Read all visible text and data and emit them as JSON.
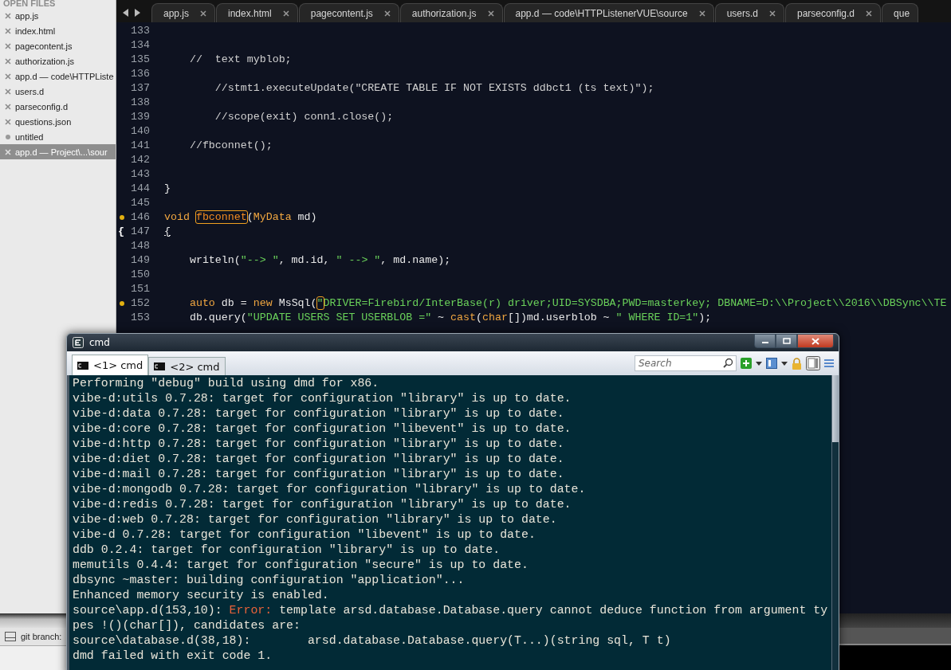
{
  "sidebar": {
    "header": "OPEN FILES",
    "items": [
      {
        "label": "app.js",
        "modified": false,
        "selected": false
      },
      {
        "label": "index.html",
        "modified": false,
        "selected": false
      },
      {
        "label": "pagecontent.js",
        "modified": false,
        "selected": false
      },
      {
        "label": "authorization.js",
        "modified": false,
        "selected": false
      },
      {
        "label": "app.d — code\\HTTPListe",
        "modified": false,
        "selected": false
      },
      {
        "label": "users.d",
        "modified": false,
        "selected": false
      },
      {
        "label": "parseconfig.d",
        "modified": false,
        "selected": false
      },
      {
        "label": "questions.json",
        "modified": false,
        "selected": false
      },
      {
        "label": "untitled",
        "modified": true,
        "selected": false
      },
      {
        "label": "app.d — Project\\...\\sour",
        "modified": false,
        "selected": true
      }
    ]
  },
  "tabs": [
    {
      "label": "app.js"
    },
    {
      "label": "index.html"
    },
    {
      "label": "pagecontent.js"
    },
    {
      "label": "authorization.js"
    },
    {
      "label": "app.d — code\\HTTPListenerVUE\\source"
    },
    {
      "label": "users.d"
    },
    {
      "label": "parseconfig.d"
    },
    {
      "label": "que"
    }
  ],
  "editor": {
    "lines": [
      {
        "number": "133",
        "marker": false
      },
      {
        "number": "134",
        "marker": false
      },
      {
        "number": "135",
        "marker": false,
        "segments": [
          {
            "text": "    //  text myblob;",
            "kind": "comment"
          }
        ]
      },
      {
        "number": "136",
        "marker": false
      },
      {
        "number": "137",
        "marker": false,
        "segments": [
          {
            "text": "        //stmt1.executeUpdate(\"CREATE TABLE IF NOT EXISTS ddbct1 (ts text)\");",
            "kind": "comment"
          }
        ]
      },
      {
        "number": "138",
        "marker": false
      },
      {
        "number": "139",
        "marker": false,
        "segments": [
          {
            "text": "        //scope(exit) conn1.close();",
            "kind": "comment"
          }
        ]
      },
      {
        "number": "140",
        "marker": false
      },
      {
        "number": "141",
        "marker": false,
        "segments": [
          {
            "text": "    //fbconnet();",
            "kind": "comment"
          }
        ]
      },
      {
        "number": "142",
        "marker": false
      },
      {
        "number": "143",
        "marker": false
      },
      {
        "number": "144",
        "marker": false,
        "segments": [
          {
            "text": "}",
            "kind": "plain"
          }
        ]
      },
      {
        "number": "145",
        "marker": false
      },
      {
        "number": "146",
        "marker": true,
        "segments": [
          {
            "text": "void",
            "kind": "keyword"
          },
          {
            "text": " fbconnet",
            "kind": "highlight"
          },
          {
            "text": "(",
            "kind": "plain"
          },
          {
            "text": "MyData",
            "kind": "keyword"
          },
          {
            "text": " md)",
            "kind": "plain"
          }
        ]
      },
      {
        "number": "147",
        "marker": false,
        "fold": "{",
        "segments": [
          {
            "text": "{",
            "kind": "underline"
          }
        ]
      },
      {
        "number": "148",
        "marker": false
      },
      {
        "number": "149",
        "marker": false,
        "segments": [
          {
            "text": "    writeln(",
            "kind": "plain"
          },
          {
            "text": "\"--> \"",
            "kind": "string"
          },
          {
            "text": ", md.id, ",
            "kind": "plain"
          },
          {
            "text": "\" --> \"",
            "kind": "string"
          },
          {
            "text": ", md.name);",
            "kind": "plain"
          }
        ]
      },
      {
        "number": "150",
        "marker": false
      },
      {
        "number": "151",
        "marker": false
      },
      {
        "number": "152",
        "marker": true,
        "segments": [
          {
            "text": "    auto",
            "kind": "keyword"
          },
          {
            "text": " db = ",
            "kind": "plain"
          },
          {
            "text": "new",
            "kind": "keyword"
          },
          {
            "text": " MsSql(",
            "kind": "plain"
          },
          {
            "text": "\"",
            "kind": "matched"
          },
          {
            "text": "DRIVER=Firebird/InterBase(r) driver;UID=SYSDBA;PWD=masterkey; DBNAME=D:\\\\Project\\\\2016\\\\DBSync\\\\TE",
            "kind": "string"
          }
        ]
      },
      {
        "number": "153",
        "marker": false,
        "segments": [
          {
            "text": "    db.query(",
            "kind": "plain"
          },
          {
            "text": "\"UPDATE USERS SET USERBLOB =\"",
            "kind": "string"
          },
          {
            "text": " ~ ",
            "kind": "plain"
          },
          {
            "text": "cast",
            "kind": "keyword"
          },
          {
            "text": "(",
            "kind": "plain"
          },
          {
            "text": "char",
            "kind": "keyword"
          },
          {
            "text": "[])md.userblob ~ ",
            "kind": "plain"
          },
          {
            "text": "\" WHERE ID=1\"",
            "kind": "string"
          },
          {
            "text": ");",
            "kind": "plain"
          }
        ]
      }
    ]
  },
  "console": {
    "title": "cmd",
    "tabs": [
      {
        "label": "<1> cmd",
        "selected": true
      },
      {
        "label": "<2> cmd",
        "selected": false
      }
    ],
    "search": {
      "placeholder": "Search"
    },
    "lines": [
      {
        "segments": [
          {
            "text": "Performing \"debug\" build using dmd for x86.",
            "kind": "text"
          }
        ]
      },
      {
        "segments": [
          {
            "text": "vibe-d:utils 0.7.28: target for configuration \"library\" is up to date.",
            "kind": "text"
          }
        ]
      },
      {
        "segments": [
          {
            "text": "vibe-d:data 0.7.28: target for configuration \"library\" is up to date.",
            "kind": "text"
          }
        ]
      },
      {
        "segments": [
          {
            "text": "vibe-d:core 0.7.28: target for configuration \"libevent\" is up to date.",
            "kind": "text"
          }
        ]
      },
      {
        "segments": [
          {
            "text": "vibe-d:http 0.7.28: target for configuration \"library\" is up to date.",
            "kind": "text"
          }
        ]
      },
      {
        "segments": [
          {
            "text": "vibe-d:diet 0.7.28: target for configuration \"library\" is up to date.",
            "kind": "text"
          }
        ]
      },
      {
        "segments": [
          {
            "text": "vibe-d:mail 0.7.28: target for configuration \"library\" is up to date.",
            "kind": "text"
          }
        ]
      },
      {
        "segments": [
          {
            "text": "vibe-d:mongodb 0.7.28: target for configuration \"library\" is up to date.",
            "kind": "text"
          }
        ]
      },
      {
        "segments": [
          {
            "text": "vibe-d:redis 0.7.28: target for configuration \"library\" is up to date.",
            "kind": "text"
          }
        ]
      },
      {
        "segments": [
          {
            "text": "vibe-d:web 0.7.28: target for configuration \"library\" is up to date.",
            "kind": "text"
          }
        ]
      },
      {
        "segments": [
          {
            "text": "vibe-d 0.7.28: target for configuration \"libevent\" is up to date.",
            "kind": "text"
          }
        ]
      },
      {
        "segments": [
          {
            "text": "ddb 0.2.4: target for configuration \"library\" is up to date.",
            "kind": "text"
          }
        ]
      },
      {
        "segments": [
          {
            "text": "memutils 0.4.4: target for configuration \"secure\" is up to date.",
            "kind": "text"
          }
        ]
      },
      {
        "segments": [
          {
            "text": "dbsync ~master: building configuration \"application\"...",
            "kind": "text"
          }
        ]
      },
      {
        "segments": [
          {
            "text": "Enhanced memory security is enabled.",
            "kind": "text"
          }
        ]
      },
      {
        "segments": [
          {
            "text": "source\\app.d(153,10): ",
            "kind": "text"
          },
          {
            "text": "Error:",
            "kind": "error"
          },
          {
            "text": " template arsd.database.Database.query cannot deduce function from argument ty",
            "kind": "text"
          }
        ]
      },
      {
        "segments": [
          {
            "text": "pes !()(char[]), candidates are:",
            "kind": "text"
          }
        ]
      },
      {
        "segments": [
          {
            "text": "source\\database.d(38,18):        arsd.database.Database.query(T...)(string sql, T t)",
            "kind": "text"
          }
        ]
      },
      {
        "segments": [
          {
            "text": "dmd failed with exit code 1.",
            "kind": "text"
          }
        ]
      }
    ]
  },
  "status_bar": {
    "text": "git branch:"
  }
}
